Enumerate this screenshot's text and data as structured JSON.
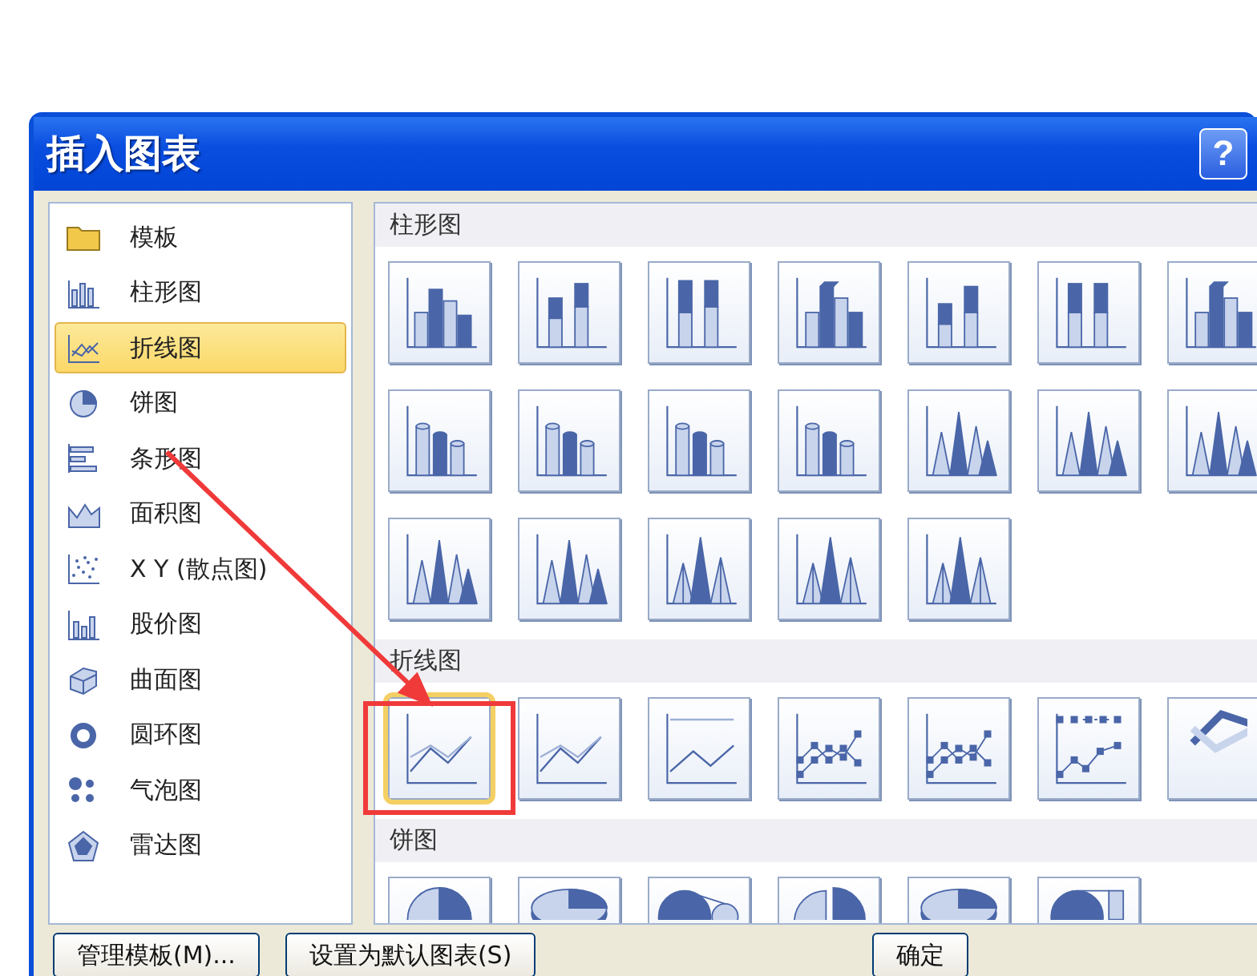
{
  "window": {
    "title": "插入图表",
    "help": "?"
  },
  "categories": [
    {
      "kind": "folder",
      "label": "模板",
      "selected": false
    },
    {
      "kind": "column",
      "label": "柱形图",
      "selected": false
    },
    {
      "kind": "line",
      "label": "折线图",
      "selected": true
    },
    {
      "kind": "pie",
      "label": "饼图",
      "selected": false
    },
    {
      "kind": "bar",
      "label": "条形图",
      "selected": false
    },
    {
      "kind": "area",
      "label": "面积图",
      "selected": false
    },
    {
      "kind": "scatter",
      "label": "X Y (散点图)",
      "selected": false
    },
    {
      "kind": "stock",
      "label": "股价图",
      "selected": false
    },
    {
      "kind": "surface",
      "label": "曲面图",
      "selected": false
    },
    {
      "kind": "doughnut",
      "label": "圆环图",
      "selected": false
    },
    {
      "kind": "bubble",
      "label": "气泡图",
      "selected": false
    },
    {
      "kind": "radar",
      "label": "雷达图",
      "selected": false
    }
  ],
  "gallery": [
    {
      "heading": "柱形图",
      "rows": [
        [
          {
            "kind": "col",
            "selected": false
          },
          {
            "kind": "colstack",
            "selected": false
          },
          {
            "kind": "colfull",
            "selected": false
          },
          {
            "kind": "col3d",
            "selected": false
          },
          {
            "kind": "colstack3d",
            "selected": false
          },
          {
            "kind": "colfull3d",
            "selected": false
          },
          {
            "kind": "col3d",
            "selected": false
          }
        ],
        [
          {
            "kind": "cyl",
            "selected": false
          },
          {
            "kind": "cyl",
            "selected": false
          },
          {
            "kind": "cyl",
            "selected": false
          },
          {
            "kind": "cyl",
            "selected": false
          },
          {
            "kind": "cone",
            "selected": false
          },
          {
            "kind": "cone",
            "selected": false
          },
          {
            "kind": "cone",
            "selected": false
          }
        ],
        [
          {
            "kind": "cone",
            "selected": false
          },
          {
            "kind": "cone",
            "selected": false
          },
          {
            "kind": "pyramid",
            "selected": false
          },
          {
            "kind": "pyramid",
            "selected": false
          },
          {
            "kind": "pyramid",
            "selected": false
          }
        ]
      ]
    },
    {
      "heading": "折线图",
      "rows": [
        [
          {
            "kind": "line",
            "selected": true
          },
          {
            "kind": "line",
            "selected": false
          },
          {
            "kind": "linefull",
            "selected": false
          },
          {
            "kind": "linemark",
            "selected": false
          },
          {
            "kind": "linemark",
            "selected": false
          },
          {
            "kind": "linemarkfull",
            "selected": false
          },
          {
            "kind": "line3d",
            "selected": false
          }
        ]
      ]
    },
    {
      "heading": "饼图",
      "rows": [
        [
          {
            "kind": "pie",
            "selected": false
          },
          {
            "kind": "pie3d",
            "selected": false
          },
          {
            "kind": "pieofpie",
            "selected": false
          },
          {
            "kind": "pieexplode",
            "selected": false
          },
          {
            "kind": "pie3d",
            "selected": false
          },
          {
            "kind": "barofpie",
            "selected": false
          }
        ]
      ]
    }
  ],
  "buttons": [
    {
      "label": "管理模板(M)..."
    },
    {
      "label": "设置为默认图表(S)"
    },
    {
      "label": "确定"
    }
  ]
}
